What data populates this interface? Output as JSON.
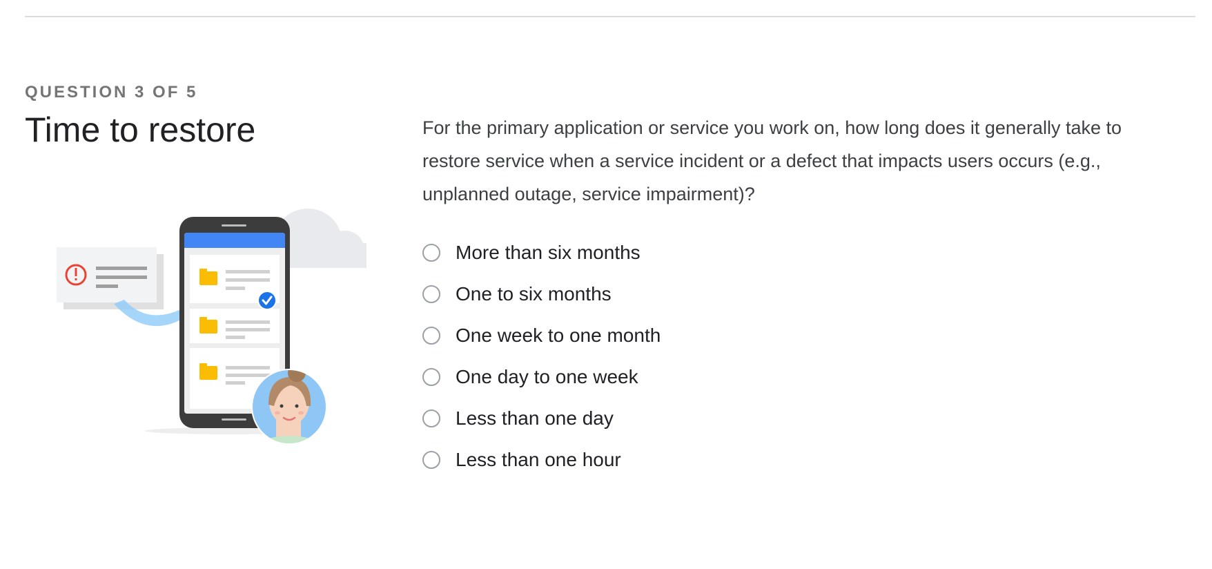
{
  "question": {
    "eyebrow": "QUESTION 3 OF 5",
    "title": "Time to restore",
    "text": "For the primary application or service you work on, how long does it generally take to restore service when a service incident or a defect that impacts users occurs (e.g., unplanned outage, service impairment)?",
    "options": [
      {
        "label": "More than six months",
        "selected": false
      },
      {
        "label": "One to six months",
        "selected": false
      },
      {
        "label": "One week to one month",
        "selected": false
      },
      {
        "label": "One day to one week",
        "selected": false
      },
      {
        "label": "Less than one day",
        "selected": false
      },
      {
        "label": "Less than one hour",
        "selected": false
      }
    ]
  },
  "illustration": {
    "icons": [
      "alert-icon",
      "folder-icon",
      "check-circle-icon",
      "arrow-icon",
      "person-avatar",
      "cloud"
    ]
  },
  "colors": {
    "accent_blue": "#4285f4",
    "alert_red": "#ea4335",
    "folder_yellow": "#fbbc04",
    "phone_dark": "#3c3c3c",
    "radio_border": "#9aa0a6"
  }
}
